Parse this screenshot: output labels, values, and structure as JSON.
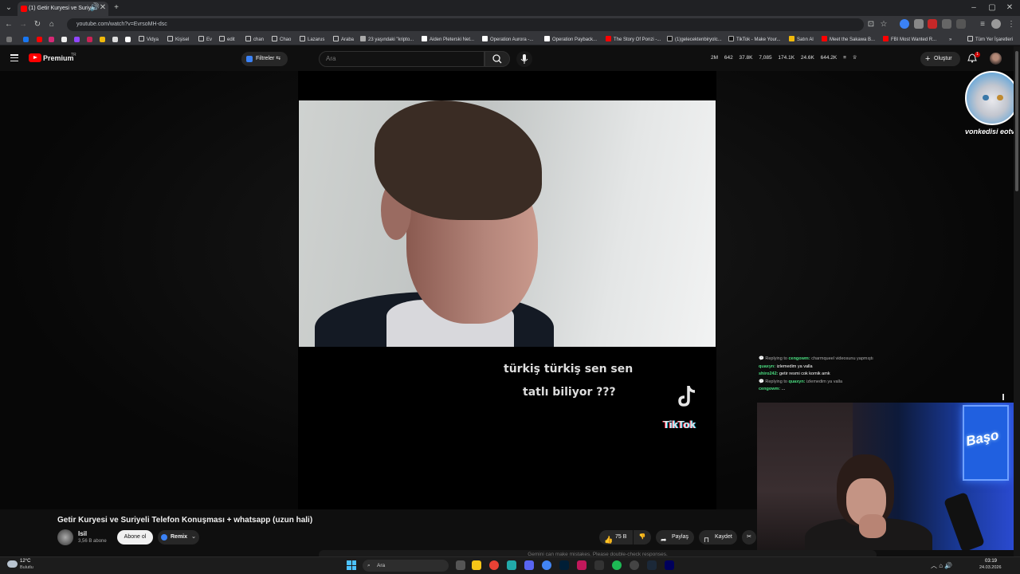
{
  "browser": {
    "tab_title": "(1) Getir Kuryesi ve Suriyeli",
    "url": "youtube.com/watch?v=EvrsoMH-dsc",
    "bookmarks": [
      "Vidya",
      "Kişisel",
      "Ev",
      "edit",
      "chan",
      "Chao",
      "Lazarus",
      "Araba",
      "23 yaşındaki \"kripto...",
      "Aiden Pleterski Net...",
      "Operation Aurora -...",
      "Operation Payback...",
      "The Story Of Ponzi -...",
      "(1)gelecektenbiryolc...",
      "TikTok - Make Your...",
      "Satın Al",
      "Meet the Sakawa B...",
      "FBI Most Wanted R..."
    ],
    "bookmarks_all": "Tüm Yer İşaretleri",
    "bookmarks_more": "»"
  },
  "youtube": {
    "brand": "Premium",
    "brand_region": "TR",
    "filter_label": "Filtreler",
    "search_placeholder": "Ara",
    "stats": [
      "2M",
      "642",
      "37.8K",
      "7,085",
      "174.1K",
      "24.6K",
      "644.2K"
    ],
    "create_label": "Oluştur",
    "notification_count": "1"
  },
  "video": {
    "caption_line1": "türkiş türkiş sen sen",
    "caption_line2": "tatlı biliyor ???",
    "watermark": "TikTok",
    "title": "Getir Kuryesi ve Suriyeli Telefon Konuşması + whatsapp (uzun hali)",
    "channel_name": "Isil",
    "channel_subs": "3,56 B abone",
    "subscribe_label": "Abone ol",
    "remix_label": "Remix",
    "like_count": "75 B",
    "share_label": "Paylaş",
    "save_label": "Kaydet"
  },
  "stream_overlay": {
    "streamer_name": "vonkedisi eotv",
    "webcam_sign": "Başo",
    "chat": [
      {
        "type": "reply",
        "text": "Replying to",
        "user": "cengowm:",
        "msg": "charmqueel videosunu yapmıştı"
      },
      {
        "type": "msg",
        "user": "quaxyn:",
        "msg": "izlemedim ya valla"
      },
      {
        "type": "msg",
        "user": "shiro242:",
        "msg": "getir resmi cok komik amk"
      },
      {
        "type": "reply",
        "text": "Replying to",
        "user": "quaxyn:",
        "msg": "izlemedim ya valla"
      },
      {
        "type": "msg",
        "user": "cengowm:",
        "msg": "..."
      }
    ]
  },
  "gemini_notice": "Gemini can make mistakes. Please double-check responses.",
  "taskbar": {
    "weather_temp": "12°C",
    "weather_desc": "Bulutlu",
    "search_label": "Ara",
    "time": "03:19",
    "date": "24.03.2026"
  },
  "colors": {
    "accent": "#ff0000",
    "chat_user": "#4ade80",
    "neon_blue": "#2060e0"
  }
}
